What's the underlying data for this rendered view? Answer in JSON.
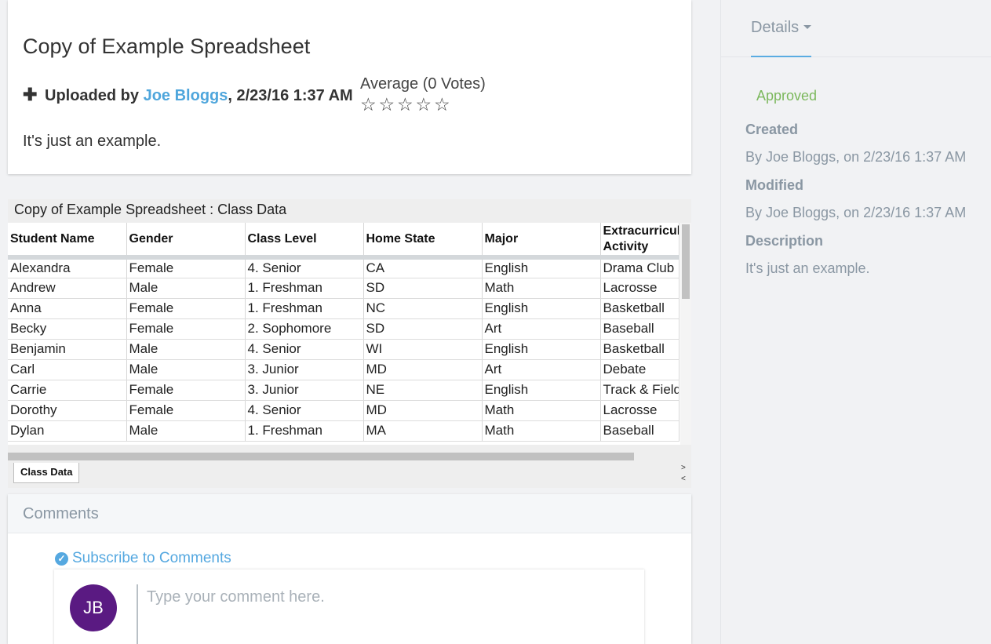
{
  "document": {
    "title": "Copy of Example Spreadsheet",
    "uploaded_prefix": "Uploaded by",
    "author": "Joe Bloggs",
    "uploaded_date": ", 2/23/16 1:37 AM",
    "rating_label": "Average (0 Votes)",
    "rating_value": 0,
    "rating_max": 5,
    "description": "It's just an example."
  },
  "sheet": {
    "title": "Copy of Example Spreadsheet : Class Data",
    "columns": [
      "Student Name",
      "Gender",
      "Class Level",
      "Home State",
      "Major",
      "Extracurricular Activity"
    ],
    "rows": [
      [
        "Alexandra",
        "Female",
        "4. Senior",
        "CA",
        "English",
        "Drama Club"
      ],
      [
        "Andrew",
        "Male",
        "1. Freshman",
        "SD",
        "Math",
        "Lacrosse"
      ],
      [
        "Anna",
        "Female",
        "1. Freshman",
        "NC",
        "English",
        "Basketball"
      ],
      [
        "Becky",
        "Female",
        "2. Sophomore",
        "SD",
        "Art",
        "Baseball"
      ],
      [
        "Benjamin",
        "Male",
        "4. Senior",
        "WI",
        "English",
        "Basketball"
      ],
      [
        "Carl",
        "Male",
        "3. Junior",
        "MD",
        "Art",
        "Debate"
      ],
      [
        "Carrie",
        "Female",
        "3. Junior",
        "NE",
        "English",
        "Track & Field"
      ],
      [
        "Dorothy",
        "Female",
        "4. Senior",
        "MD",
        "Math",
        "Lacrosse"
      ],
      [
        "Dylan",
        "Male",
        "1. Freshman",
        "MA",
        "Math",
        "Baseball"
      ]
    ],
    "tab_label": "Class Data",
    "nav_next": ">",
    "nav_prev": "<"
  },
  "comments": {
    "header": "Comments",
    "subscribe_label": "Subscribe to Comments",
    "avatar_initials": "JB",
    "input_placeholder": "Type your comment here.",
    "input_value": ""
  },
  "details": {
    "tab_label": "Details",
    "status": "Approved",
    "created_label": "Created",
    "created_value": "By Joe Bloggs, on 2/23/16 1:37 AM",
    "modified_label": "Modified",
    "modified_value": "By Joe Bloggs, on 2/23/16 1:37 AM",
    "description_label": "Description",
    "description_value": "It's just an example."
  },
  "colors": {
    "link": "#4fa6dc",
    "approved": "#7cb85d",
    "avatar": "#5a1a82",
    "muted": "#8a97a3"
  }
}
